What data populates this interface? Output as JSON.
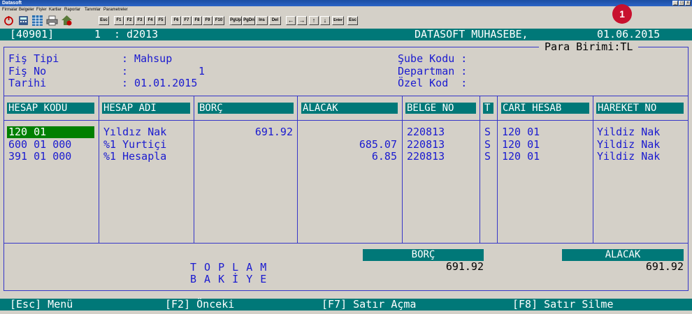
{
  "window": {
    "title": "Datasoft",
    "btn_min": "_",
    "btn_max": "□",
    "btn_close": "x"
  },
  "menu": [
    "Firmalar",
    "Belgeler",
    "Fişler",
    "Kartlar",
    "Raporlar",
    "Tanımlar",
    "Parametreler"
  ],
  "toolbar": {
    "buttons": [
      "Esc",
      "F1",
      "F2",
      "F3",
      "F4",
      "F5",
      "F6",
      "F7",
      "F8",
      "F9",
      "F10",
      "PgUp",
      "PgDn",
      "Ins",
      "Del",
      "Enter",
      "Esc"
    ],
    "arrows": [
      "←",
      "→",
      "↑",
      "↓"
    ],
    "icons": [
      "power-icon",
      "calculator-icon",
      "grid-icon",
      "printer-icon",
      "home-icon"
    ]
  },
  "notification_count": "1",
  "status": {
    "code": "[40901]",
    "num": "1",
    "period": ": d2013",
    "app": "DATASOFT MUHASEBE,",
    "date": "01.06.2015",
    "currency": "Para Birimi:TL"
  },
  "form": {
    "fis_tipi_label": "Fiş Tipi",
    "fis_tipi_value": ": Mahsup",
    "fis_no_label": "Fiş No",
    "fis_no_colon": ":",
    "fis_no_value": "1",
    "tarih_label": "Tarihi",
    "tarih_value": ": 01.01.2015",
    "sube_label": "Şube Kodu :",
    "departman_label": "Departman :",
    "ozel_label": "Özel Kod  :"
  },
  "table": {
    "headers": [
      "HESAP KODU",
      "HESAP ADI",
      "BORÇ",
      "ALACAK",
      "BELGE NO",
      "T",
      "CARI HESAB",
      "HAREKET NO"
    ],
    "rows": [
      {
        "kod": "120 01",
        "ad": "Yıldız Nak",
        "borc": "691.92",
        "alacak": "",
        "belge": "220813",
        "t": "S",
        "cari": "120 01",
        "hareket": "Yildiz Nak"
      },
      {
        "kod": "600 01 000",
        "ad": "%1 Yurtiçi",
        "borc": "",
        "alacak": "685.07",
        "belge": "220813",
        "t": "S",
        "cari": "120 01",
        "hareket": "Yildiz Nak"
      },
      {
        "kod": "391 01 000",
        "ad": "%1 Hesapla",
        "borc": "",
        "alacak": "6.85",
        "belge": "220813",
        "t": "S",
        "cari": "120 01",
        "hareket": "Yildiz Nak"
      }
    ]
  },
  "totals": {
    "toplam_label": "T O P L A M",
    "bakiye_label": "B A K İ Y E",
    "borc_label": "BORÇ",
    "borc_value": "691.92",
    "alacak_label": "ALACAK",
    "alacak_value": "691.92"
  },
  "footer": [
    "[Esc] Menü",
    "[F2] Önceki",
    "[F7] Satır Açma",
    "[F8] Satır Silme"
  ]
}
